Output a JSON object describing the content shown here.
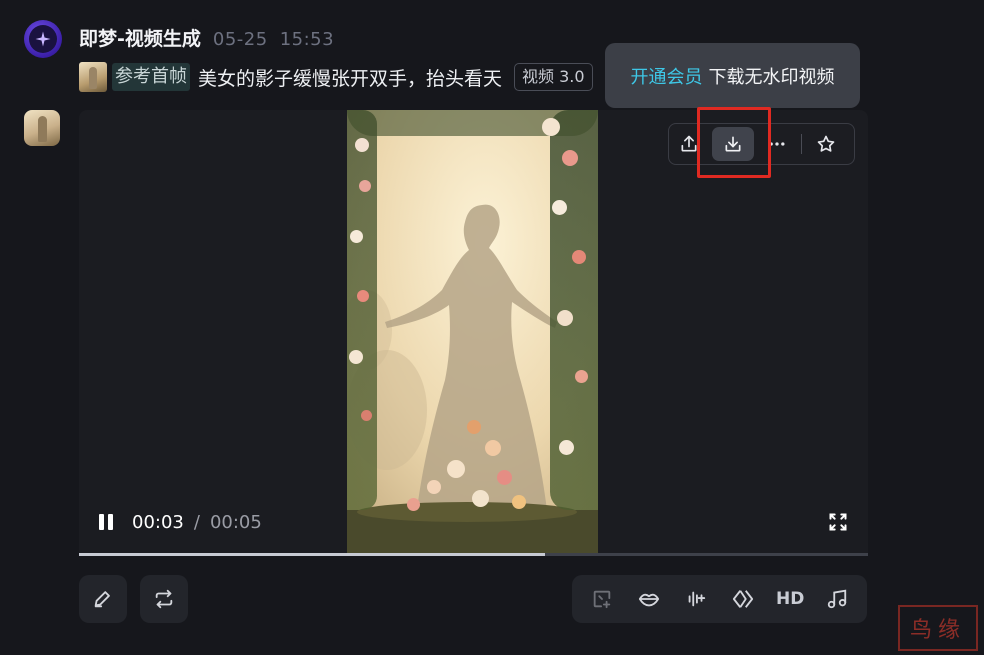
{
  "message": {
    "app_name": "即梦-视频生成",
    "date": "05-25",
    "time": "15:53",
    "reference_tag": "参考首帧",
    "prompt": "美女的影子缓慢张开双手，抬头看天",
    "model_tag": "视频 3.0"
  },
  "tooltip": {
    "vip_text": "开通会员",
    "rest_text": "下载无水印视频"
  },
  "player": {
    "current_time": "00:03",
    "separator": "/",
    "duration": "00:05",
    "progress_fraction": 0.59
  },
  "toolbar": {
    "icons": [
      "share-icon",
      "download-icon",
      "more-icon",
      "star-icon"
    ]
  },
  "bottom_tools": {
    "hd_label": "HD",
    "icons": [
      "frame-add-icon",
      "lips-icon",
      "audio-wave-icon",
      "diamond-icon",
      "hd",
      "music-icon"
    ]
  },
  "watermark": {
    "seal_text": "鸟缘",
    "color": "#a1322a"
  },
  "colors": {
    "background": "#16171c",
    "accent_vip": "#3ec7e6",
    "highlight_red": "#e02a22"
  }
}
